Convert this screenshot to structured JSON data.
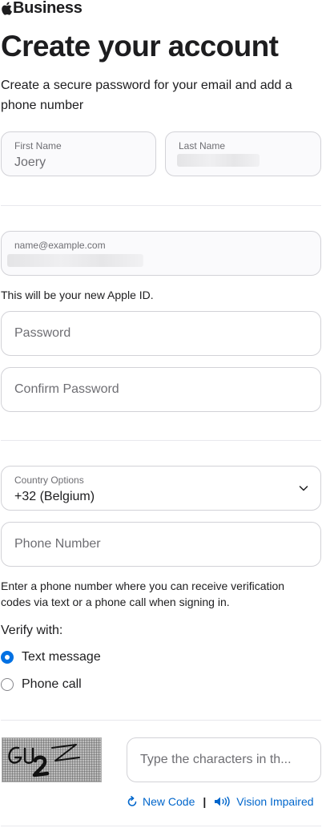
{
  "brand": {
    "logo_icon": "apple-logo-icon",
    "name": "Business"
  },
  "header": {
    "title": "Create your account",
    "subtitle": "Create a secure password for your email and add a phone number"
  },
  "name_fields": {
    "first_name_label": "First Name",
    "first_name_value": "Joery",
    "last_name_label": "Last Name"
  },
  "email": {
    "label": "name@example.com",
    "helper": "This will be your new Apple ID."
  },
  "password": {
    "placeholder": "Password",
    "confirm_placeholder": "Confirm Password"
  },
  "phone": {
    "country_label": "Country Options",
    "country_value": "+32 (Belgium)",
    "number_placeholder": "Phone Number",
    "helper": "Enter a phone number where you can receive verification codes via text or a phone call when signing in."
  },
  "verify": {
    "label": "Verify with:",
    "options": [
      {
        "label": "Text message",
        "selected": true
      },
      {
        "label": "Phone call",
        "selected": false
      }
    ]
  },
  "captcha": {
    "image_text": "GU2Z",
    "input_placeholder": "Type the characters in th...",
    "new_code_label": "New Code",
    "separator": "|",
    "vision_impaired_label": "Vision Impaired"
  },
  "colors": {
    "accent": "#0071e3",
    "link": "#0066cc",
    "border": "#d2d2d7",
    "text": "#1d1d1f",
    "muted": "#6e6e73"
  }
}
